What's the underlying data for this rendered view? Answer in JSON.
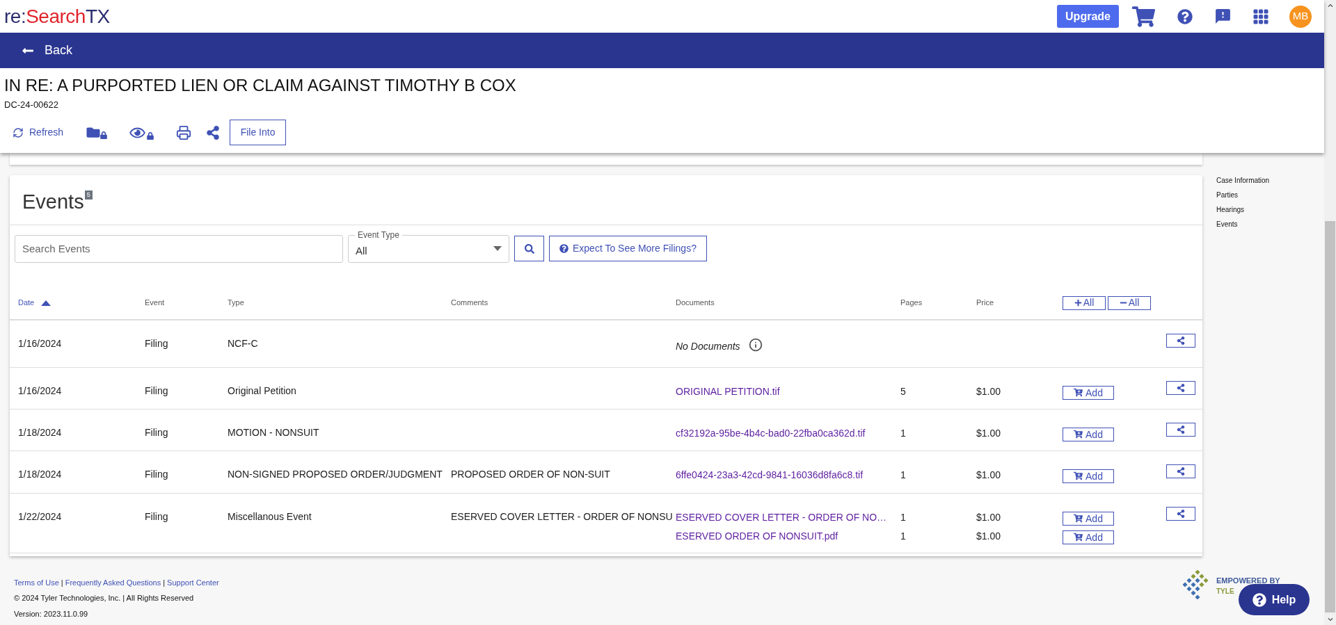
{
  "logo": {
    "prefix": "re:",
    "middle": "Search",
    "suffix": "TX"
  },
  "top_nav": {
    "upgrade": "Upgrade",
    "avatar": "MB"
  },
  "back": "Back",
  "case": {
    "title": "IN RE: A PURPORTED LIEN OR CLAIM AGAINST TIMOTHY B COX",
    "number": "DC-24-00622"
  },
  "toolbar": {
    "refresh": "Refresh",
    "file_into": "File Into"
  },
  "events": {
    "title": "Events",
    "count": "5",
    "search": {
      "placeholder": "Search Events"
    },
    "event_type": {
      "label": "Event Type",
      "value": "All"
    },
    "more_filings": "Expect To See More Filings?",
    "columns": [
      {
        "label": "Date",
        "sorted": true
      },
      {
        "label": "Event",
        "sorted": false
      },
      {
        "label": "Type",
        "sorted": false
      },
      {
        "label": "Comments",
        "sorted": false
      },
      {
        "label": "Documents",
        "sorted": false
      },
      {
        "label": "Pages",
        "sorted": false
      },
      {
        "label": "Price",
        "sorted": false
      }
    ],
    "expand_all": "All",
    "collapse_all": "All",
    "rows": [
      {
        "date": "1/16/2024",
        "event": "Filing",
        "type": "NCF-C",
        "no_documents": "No Documents"
      },
      {
        "date": "1/16/2024",
        "event": "Filing",
        "type": "Original Petition",
        "documents": [
          {
            "name": "ORIGINAL PETITION.tif",
            "pages": "5",
            "price": "$1.00",
            "add": "Add"
          }
        ]
      },
      {
        "date": "1/18/2024",
        "event": "Filing",
        "type": "MOTION - NONSUIT",
        "documents": [
          {
            "name": "cf32192a-95be-4b4c-bad0-22fba0ca362d.tif",
            "pages": "1",
            "price": "$1.00",
            "add": "Add"
          }
        ]
      },
      {
        "date": "1/18/2024",
        "event": "Filing",
        "type": "NON-SIGNED PROPOSED ORDER/JUDGMENT",
        "comments": "PROPOSED ORDER OF NON-SUIT",
        "documents": [
          {
            "name": "6ffe0424-23a3-42cd-9841-16036d8fa6c8.tif",
            "pages": "1",
            "price": "$1.00",
            "add": "Add"
          }
        ]
      },
      {
        "date": "1/22/2024",
        "event": "Filing",
        "type": "Miscellanous Event",
        "comments": "ESERVED COVER LETTER - ORDER OF NONSU",
        "documents": [
          {
            "name": "ESERVED COVER LETTER - ORDER OF NO…",
            "pages": "1",
            "price": "$1.00",
            "add": "Add"
          },
          {
            "name": "ESERVED ORDER OF NONSUIT.pdf",
            "pages": "1",
            "price": "$1.00",
            "add": "Add"
          }
        ]
      }
    ]
  },
  "side_nav": [
    "Case Information",
    "Parties",
    "Hearings",
    "Events"
  ],
  "footer": {
    "links": [
      "Terms of Use",
      "Frequently Asked Questions",
      "Support Center"
    ],
    "separator": "|",
    "copyright": "© 2024 Tyler Technologies, Inc. | All Rights Reserved",
    "version": "Version: 2023.11.0.99",
    "brand_top": "EMPOWERED BY",
    "brand_bottom": "TYLE"
  },
  "help": "Help"
}
